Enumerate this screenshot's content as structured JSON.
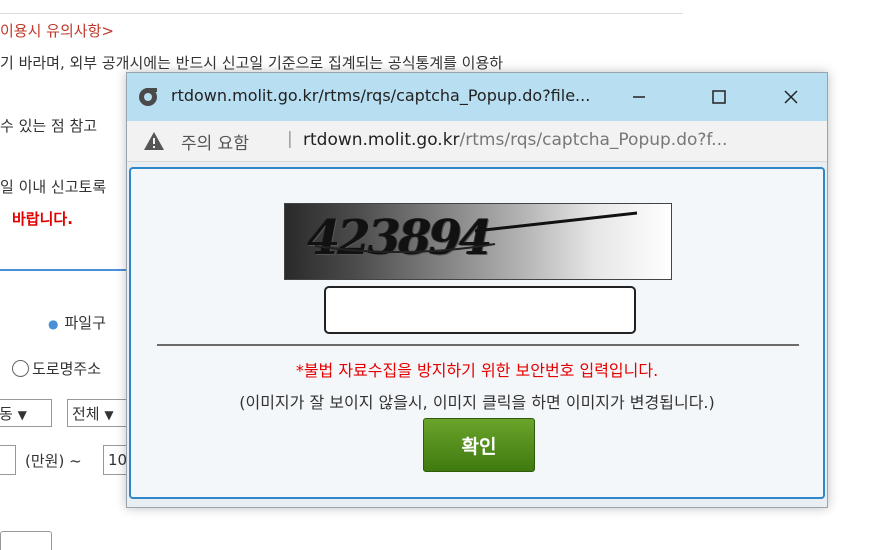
{
  "background": {
    "notice_title": "이용시 유의사항>",
    "line1": "기 바라며, 외부 공개시에는 반드시 신고일 기준으로 집계되는 공식통계를 이용하",
    "line2": "수 있는 점 참고",
    "line3": "일 이내 신고토록",
    "line4": "바랍니다.",
    "file_label": "파일구",
    "radio_label": "도로명주소",
    "select1_value": "동",
    "select2_value": "전체",
    "unit_text": "(만원) ~",
    "input_value": "10"
  },
  "popup": {
    "title": "rtdown.molit.go.kr/rtms/rqs/captcha_Popup.do?file...",
    "address": {
      "warning_text": "주의 요함",
      "divider": "|",
      "host": "rtdown.molit.go.kr",
      "path": "/rtms/rqs/captcha_Popup.do?f..."
    },
    "captcha_text": "423894",
    "captcha_input_value": "",
    "message_red": "*불법 자료수집을 방지하기 위한 보안번호 입력입니다.",
    "message_help": "(이미지가 잘 보이지 않을시, 이미지 클릭을 하면 이미지가 변경됩니다.)",
    "confirm_label": "확인"
  },
  "colors": {
    "titlebar": "#b8def2",
    "content_border": "#2d87c9",
    "confirm_button": "#4e8c1c",
    "warning_red": "#e60000"
  },
  "icons": [
    "globe-icon",
    "minimize-icon",
    "maximize-icon",
    "close-icon",
    "warning-icon"
  ]
}
